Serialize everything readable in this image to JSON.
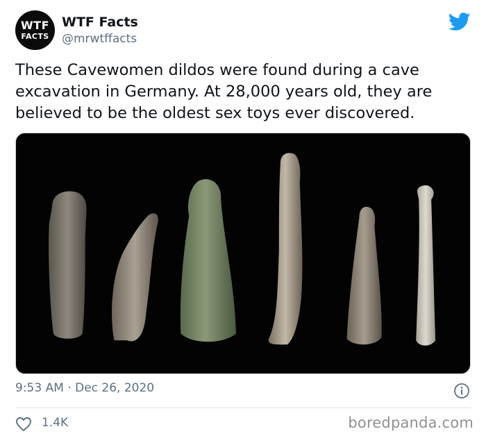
{
  "account": {
    "avatar_line1": "WTF",
    "avatar_line2": "FACTS",
    "name": "WTF Facts",
    "handle": "@mrwtffacts"
  },
  "tweet": {
    "text": "These Cavewomen dildos were found during a cave excavation in Germany. At 28,000 years old, they are believed to be the oldest sex toys ever discovered.",
    "time": "9:53 AM",
    "separator": "·",
    "date": "Dec 26, 2020",
    "likes": "1.4K"
  },
  "icons": {
    "platform": "twitter-bird-icon",
    "info": "info-icon",
    "like": "heart-icon"
  },
  "watermark": "boredpanda.com",
  "colors": {
    "twitter_blue": "#1d9bf0",
    "secondary_text": "#5b7083",
    "primary_text": "#0f1419",
    "photo_background": "#030303"
  }
}
